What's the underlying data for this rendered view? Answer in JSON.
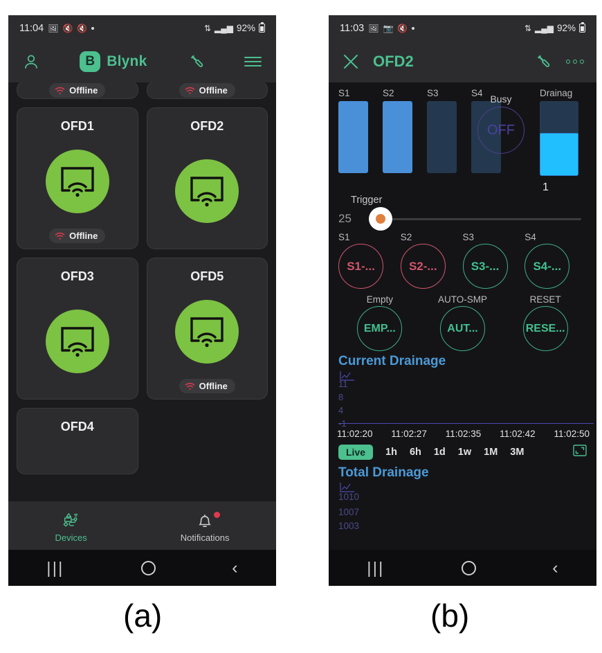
{
  "figure": {
    "caption_a": "(a)",
    "caption_b": "(b)"
  },
  "panel_a": {
    "status_bar": {
      "time": "11:04",
      "battery_percent": "92%",
      "icons": [
        "image-icon",
        "mute-icon",
        "mute-icon",
        "dot-icon",
        "data-transfer-icon",
        "signal-icon",
        "battery-icon"
      ]
    },
    "app_bar": {
      "profile_icon": "person-icon",
      "brand_initial": "B",
      "brand_name": "Blynk",
      "settings_icon": "wrench-icon",
      "menu_icon": "hamburger-icon"
    },
    "devices": [
      {
        "name": "",
        "status": "Offline",
        "clipped": "top"
      },
      {
        "name": "",
        "status": "Offline",
        "clipped": "top"
      },
      {
        "name": "OFD1",
        "status": "Offline",
        "clipped": "none"
      },
      {
        "name": "OFD2",
        "status": "",
        "clipped": "none"
      },
      {
        "name": "OFD3",
        "status": "",
        "clipped": "none"
      },
      {
        "name": "OFD5",
        "status": "Offline",
        "clipped": "none"
      },
      {
        "name": "OFD4",
        "status": "",
        "clipped": "bottom"
      }
    ],
    "bottom_nav": [
      {
        "label": "Devices",
        "icon": "devices-icon",
        "active": true,
        "badge": false
      },
      {
        "label": "Notifications",
        "icon": "bell-icon",
        "active": false,
        "badge": true
      }
    ],
    "system_nav": {
      "recents": "|||",
      "home": "home-circle-icon",
      "back": "back-chevron-icon"
    }
  },
  "panel_b": {
    "status_bar": {
      "time": "11:03",
      "battery_percent": "92%"
    },
    "app_bar": {
      "close_icon": "close-x-icon",
      "title": "OFD2",
      "settings_icon": "wrench-icon",
      "more_icon": "three-dots-icon"
    },
    "gauges": [
      {
        "label": "S1",
        "state": "on"
      },
      {
        "label": "S2",
        "state": "on"
      },
      {
        "label": "S3",
        "state": "off"
      },
      {
        "label": "S4",
        "state": "off"
      }
    ],
    "busy": {
      "label": "Busy",
      "value": "OFF"
    },
    "drainage_level": {
      "label": "Drainag",
      "value": "1",
      "fill_percent": 57
    },
    "trigger": {
      "label": "Trigger",
      "value": "25"
    },
    "sensor_buttons": [
      {
        "label": "S1",
        "text": "S1-...",
        "color": "red"
      },
      {
        "label": "S2",
        "text": "S2-...",
        "color": "red"
      },
      {
        "label": "S3",
        "text": "S3-...",
        "color": "green"
      },
      {
        "label": "S4",
        "text": "S4-...",
        "color": "green"
      }
    ],
    "action_buttons": [
      {
        "label": "Empty",
        "text": "EMP...",
        "color": "green"
      },
      {
        "label": "AUTO-SMP",
        "text": "AUT...",
        "color": "green"
      },
      {
        "label": "RESET",
        "text": "RESE...",
        "color": "green"
      }
    ],
    "range_selector": {
      "options": [
        "Live",
        "1h",
        "6h",
        "1d",
        "1w",
        "1M",
        "3M"
      ],
      "selected": "Live",
      "expand_icon": "expand-icon"
    },
    "system_nav": {
      "recents": "|||",
      "home": "home-circle-icon",
      "back": "back-chevron-icon"
    }
  },
  "chart_data": [
    {
      "type": "line",
      "title": "Current Drainage",
      "xlabel": "",
      "ylabel": "",
      "x": [
        "11:02:20",
        "11:02:27",
        "11:02:35",
        "11:02:42",
        "11:02:50"
      ],
      "yticks": [
        "11",
        "8",
        "4",
        "-1"
      ],
      "ylim": [
        -1,
        12
      ],
      "series": [
        {
          "name": "Current Drainage",
          "values": [
            0,
            0,
            0,
            0,
            0
          ]
        }
      ],
      "grid": false,
      "legend": "none",
      "note": "flat line at baseline -1"
    },
    {
      "type": "line",
      "title": "Total Drainage",
      "xlabel": "",
      "ylabel": "",
      "x": [],
      "yticks": [
        "1010",
        "1007",
        "1003"
      ],
      "ylim": [
        1003,
        1010
      ],
      "series": [
        {
          "name": "Total Drainage",
          "values": []
        }
      ],
      "grid": false,
      "legend": "none",
      "note": "partially cut off by system navigation bar"
    }
  ],
  "colors": {
    "brand_green": "#4CC08F",
    "device_green": "#7CC243",
    "offline_red": "#d2566a",
    "chart_blue": "#4b9ad6",
    "gauge_on": "#4a90d9",
    "gauge_off": "#24394f",
    "drain_cyan": "#22BFFF",
    "slider_orange": "#e08040",
    "busy_purple": "#4c41a0",
    "panel_bg": "#141417",
    "card_bg": "#2c2c2e"
  }
}
